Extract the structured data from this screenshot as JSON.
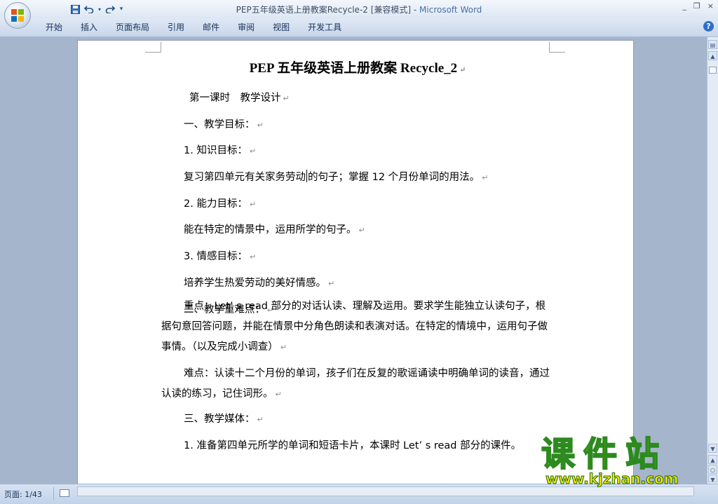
{
  "window": {
    "title_doc": "PEP五年级英语上册教案Recycle-2 [兼容模式] - ",
    "title_app": "Microsoft Word",
    "controls": [
      "_",
      "❐",
      "×"
    ]
  },
  "qat": {
    "save_icon": "save-icon",
    "undo_icon": "undo-icon",
    "redo_icon": "redo-icon",
    "customize_glyph": "▾"
  },
  "menu": {
    "tabs": [
      "开始",
      "插入",
      "页面布局",
      "引用",
      "邮件",
      "审阅",
      "视图",
      "开发工具"
    ],
    "help_label": "?"
  },
  "document": {
    "title": "PEP 五年级英语上册教案 Recycle_2",
    "paragraph_mark": "↵",
    "paragraphs": [
      {
        "text": "第一课时　教学设计"
      },
      {
        "text": "一、教学目标："
      },
      {
        "text": "1. 知识目标："
      },
      {
        "text_before": "复习第四单元有关家务劳动",
        "text_after": "的句子；掌握 12 个月份单词的用法。"
      },
      {
        "text": "2. 能力目标："
      },
      {
        "text": "能在特定的情景中，运用所学的句子。"
      },
      {
        "text": "3. 情感目标："
      },
      {
        "text": "培养学生热爱劳动的美好情感。"
      },
      {
        "text": "二、教学重难点："
      },
      {
        "text": "重点：Let’ s read 部分的对话认读、理解及运用。要求学生能独立认读句子，根据句意回答问题，并能在情景中分角色朗读和表演对话。在特定的情境中，运用句子做事情。（以及完成小调查）"
      },
      {
        "text": "难点：认读十二个月份的单词，孩子们在反复的歌谣诵读中明确单词的读音，通过认读的练习，记住词形。"
      },
      {
        "text": "三、教学媒体："
      },
      {
        "text": "1. 准备第四单元所学的单词和短语卡片，本课时 Let’ s read 部分的课件。"
      }
    ]
  },
  "status": {
    "page_info": "页面: 1/43"
  },
  "watermark": {
    "big": "课件站",
    "url": "www.kjzhan.com"
  },
  "colors": {
    "title_app": "#4a6fa5",
    "workspace": "#a5b5cc",
    "watermark_fill": "#f7e600",
    "watermark_stroke": "#2d8a1f"
  }
}
